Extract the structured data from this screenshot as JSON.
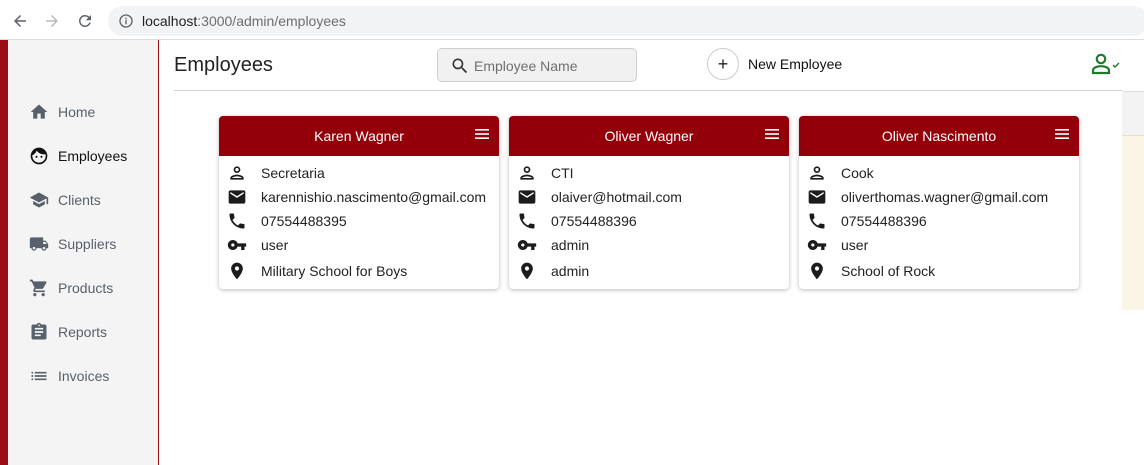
{
  "browser": {
    "url_host": "localhost",
    "url_rest": ":3000/admin/employees"
  },
  "sidebar": {
    "items": [
      {
        "label": "Home",
        "icon": "home-icon"
      },
      {
        "label": "Employees",
        "icon": "face-icon",
        "active": true
      },
      {
        "label": "Clients",
        "icon": "school-icon"
      },
      {
        "label": "Suppliers",
        "icon": "truck-icon"
      },
      {
        "label": "Products",
        "icon": "cart-icon"
      },
      {
        "label": "Reports",
        "icon": "clipboard-icon"
      },
      {
        "label": "Invoices",
        "icon": "list-icon"
      }
    ]
  },
  "header": {
    "title": "Employees",
    "search_placeholder": "Employee Name",
    "new_button_label": "New Employee"
  },
  "colors": {
    "accent": "#930009",
    "user_icon": "#1f7a2a"
  },
  "employees": [
    {
      "name": "Karen Wagner",
      "role": "Secretaria",
      "email": "karennishio.nascimento@gmail.com",
      "phone": "07554488395",
      "access": "user",
      "location": "Military School for Boys"
    },
    {
      "name": "Oliver Wagner",
      "role": "CTI",
      "email": "olaiver@hotmail.com",
      "phone": "07554488396",
      "access": "admin",
      "location": "admin"
    },
    {
      "name": "Oliver Nascimento",
      "role": "Cook",
      "email": "oliverthomas.wagner@gmail.com",
      "phone": "07554488396",
      "access": "user",
      "location": "School of Rock"
    }
  ]
}
